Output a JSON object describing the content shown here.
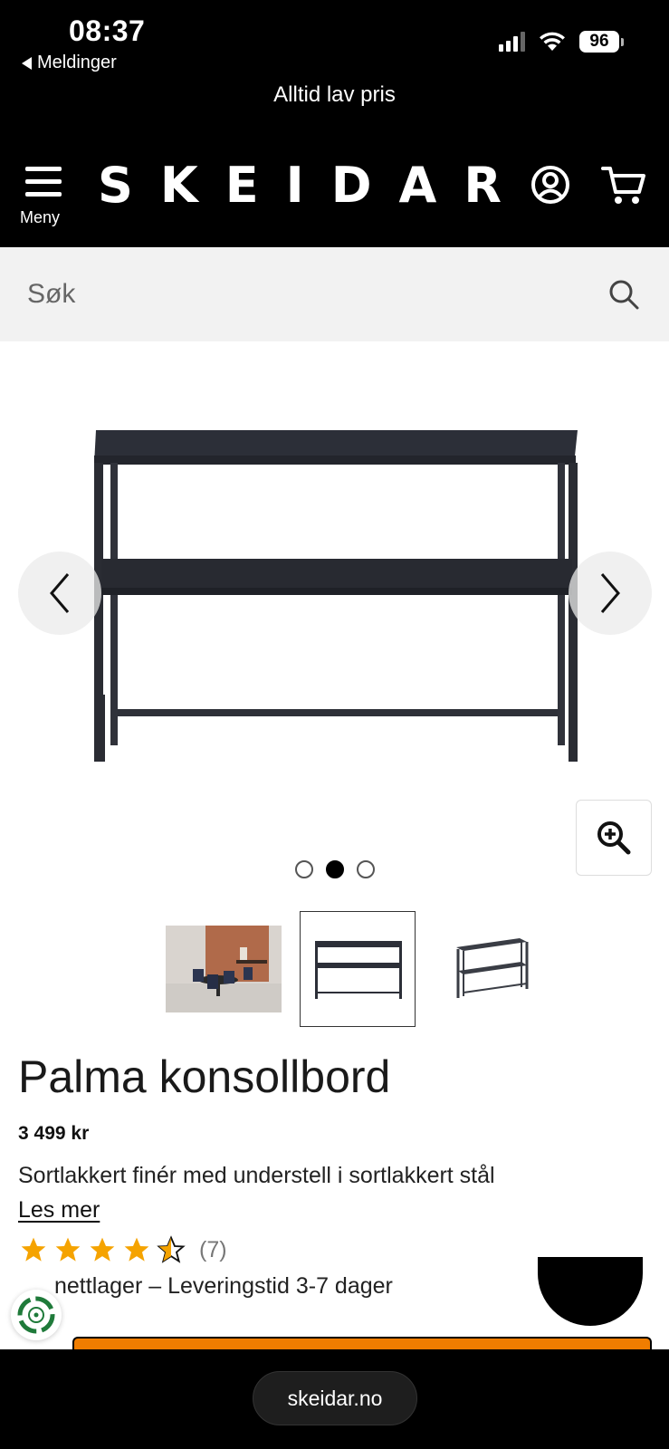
{
  "status_bar": {
    "time": "08:37",
    "back_app": "Meldinger",
    "battery": "96"
  },
  "header": {
    "tagline": "Alltid lav pris",
    "logo": "SKEIDAR",
    "menu_label": "Meny"
  },
  "search": {
    "placeholder": "Søk"
  },
  "gallery": {
    "active_index": 1,
    "dot_count": 3,
    "thumbnails": [
      "lifestyle-photo",
      "front-view",
      "angle-view"
    ]
  },
  "product": {
    "title": "Palma konsollbord",
    "price": "3 499 kr",
    "description": "Sortlakkert finér med understell i sortlakkert stål",
    "read_more": "Les mer",
    "rating": 4.5,
    "review_count": "(7)",
    "stock": "nettlager – Leveringstid 3-7 dager"
  },
  "browser": {
    "url": "skeidar.no"
  },
  "colors": {
    "header_bg": "#000000",
    "accent": "#f07d00",
    "star": "#f5a300",
    "search_bg": "#f2f2f2"
  }
}
